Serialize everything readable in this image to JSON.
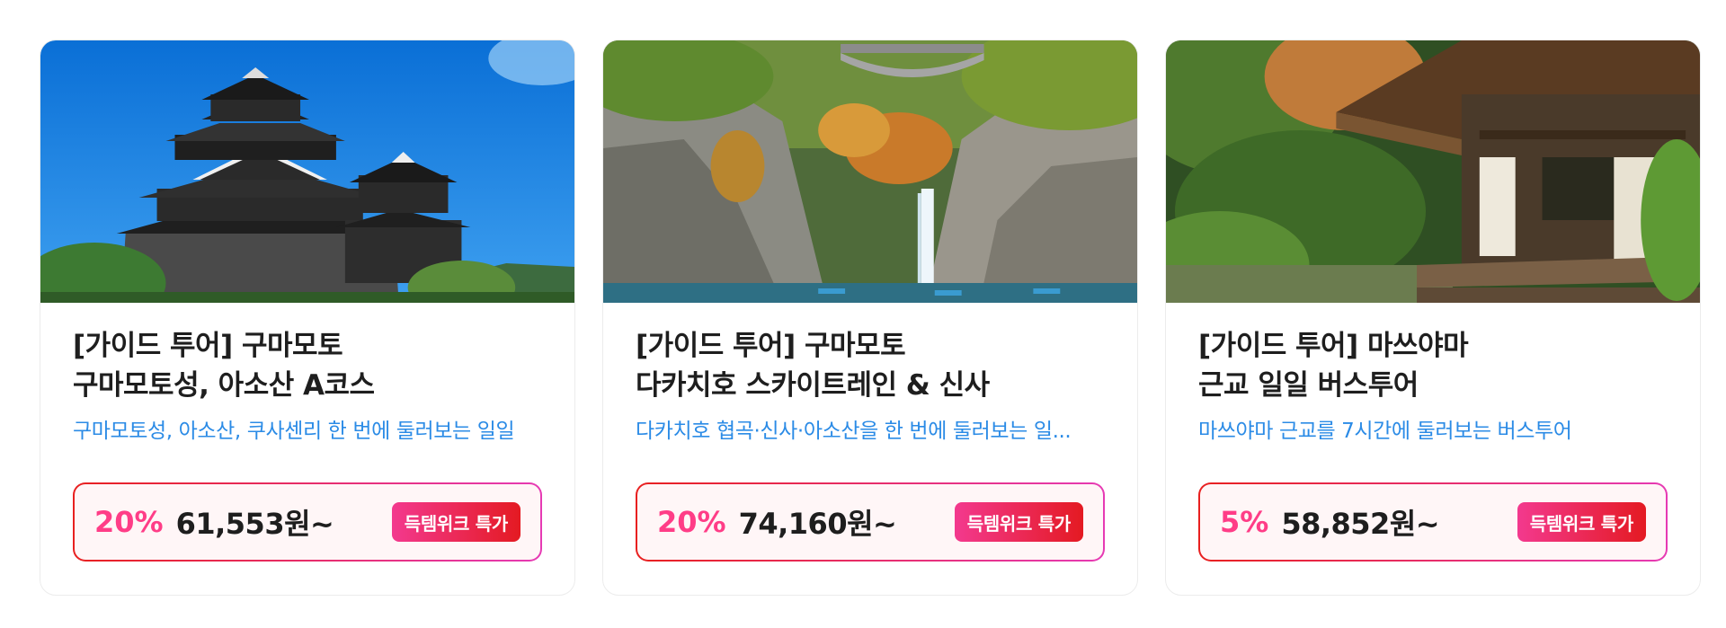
{
  "cards": [
    {
      "image": "kumamoto-castle-photo",
      "title_line1": "[가이드 투어] 구마모토",
      "title_line2": "구마모토성, 아소산 A코스",
      "description": "구마모토성, 아소산, 쿠사센리 한 번에 둘러보는 일일",
      "discount": "20%",
      "price": "61,553원~",
      "badge": "득템위크 특가"
    },
    {
      "image": "takachiho-gorge-photo",
      "title_line1": "[가이드 투어] 구마모토",
      "title_line2": "다카치호 스카이트레인 & 신사",
      "description": "다카치호 협곡·신사·아소산을 한 번에 둘러보는 일...",
      "discount": "20%",
      "price": "74,160원~",
      "badge": "득템위크 특가"
    },
    {
      "image": "matsuyama-pavilion-photo",
      "title_line1": "[가이드 투어] 마쓰야마",
      "title_line2": "근교 일일 버스투어",
      "description": "마쓰야마 근교를 7시간에 둘러보는 버스투어",
      "discount": "5%",
      "price": "58,852원~",
      "badge": "득템위크 특가"
    }
  ],
  "colors": {
    "description": "#2b8be6",
    "discount": "#ff3d87",
    "price_border_start": "#e8201f",
    "price_border_end": "#e63ab4",
    "badge_start": "#f3398e",
    "badge_end": "#e41a22"
  }
}
